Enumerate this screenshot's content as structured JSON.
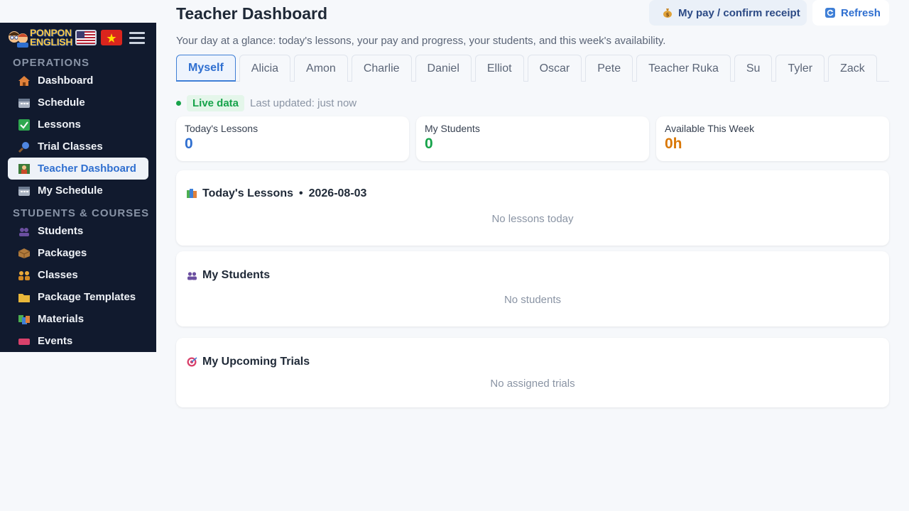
{
  "sidebar": {
    "brand": {
      "line1": "PONPON",
      "line2": "ENGLISH"
    },
    "sections": [
      {
        "title": "OPERATIONS",
        "items": [
          {
            "label": "Dashboard",
            "icon": "house-icon"
          },
          {
            "label": "Schedule",
            "icon": "calendar-icon"
          },
          {
            "label": "Lessons",
            "icon": "checkbox-icon"
          },
          {
            "label": "Trial Classes",
            "icon": "magnifier-icon"
          },
          {
            "label": "Teacher Dashboard",
            "icon": "teacher-icon",
            "active": true
          },
          {
            "label": "My Schedule",
            "icon": "calendar-icon"
          }
        ]
      },
      {
        "title": "STUDENTS & COURSES",
        "items": [
          {
            "label": "Students",
            "icon": "people-icon"
          },
          {
            "label": "Packages",
            "icon": "package-icon"
          },
          {
            "label": "Classes",
            "icon": "group-icon"
          },
          {
            "label": "Package Templates",
            "icon": "folder-icon"
          },
          {
            "label": "Materials",
            "icon": "books-icon"
          },
          {
            "label": "Events",
            "icon": "ticket-icon"
          }
        ]
      }
    ]
  },
  "header": {
    "title": "Teacher Dashboard",
    "pay_label": "My pay / confirm receipt",
    "refresh_label": "Refresh",
    "subtitle": "Your day at a glance: today's lessons, your pay and progress, your students, and this week's availability."
  },
  "tabs": [
    "Myself",
    "Alicia",
    "Amon",
    "Charlie",
    "Daniel",
    "Elliot",
    "Oscar",
    "Pete",
    "Teacher Ruka",
    "Su",
    "Tyler",
    "Zack"
  ],
  "active_tab": "Myself",
  "status": {
    "badge": "Live data",
    "updated": "Last updated: just now"
  },
  "stats": [
    {
      "label": "Today's Lessons",
      "value": "0",
      "color": "#2f6fd0"
    },
    {
      "label": "My Students",
      "value": "0",
      "color": "#16a34a"
    },
    {
      "label": "Available This Week",
      "value": "0h",
      "color": "#d97706"
    }
  ],
  "cards": {
    "lessons": {
      "title": "Today's Lessons",
      "separator": "•",
      "date": "2026-08-03",
      "empty": "No lessons today"
    },
    "students": {
      "title": "My Students",
      "empty": "No students"
    },
    "trials": {
      "title": "My Upcoming Trials",
      "empty": "No assigned trials"
    }
  }
}
